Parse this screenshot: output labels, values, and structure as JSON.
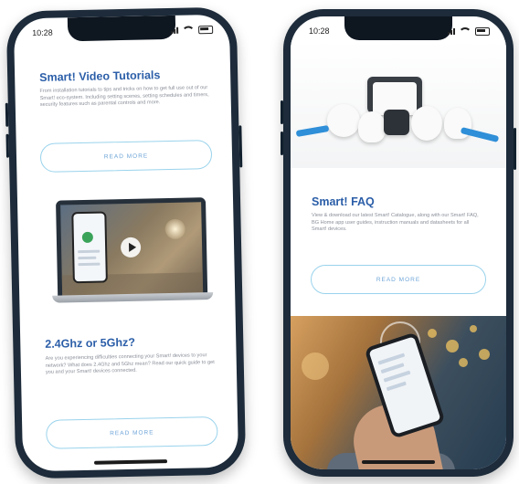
{
  "left_phone": {
    "time": "10:28",
    "section1": {
      "title": "Smart! Video Tutorials",
      "body": "From installation tutorials to tips and tricks on how to get full use out of our Smart! eco-system. Including setting scenes, setting schedules and timers, security features such as parental controls and more.",
      "button": "READ MORE"
    },
    "section2": {
      "title": "2.4Ghz or 5Ghz?",
      "body": "Are you experiencing difficulties connecting your Smart! devices to your network? What does 2.4Ghz and 5Ghz mean? Read our quick guide to get you and your Smart! devices connected.",
      "button": "READ MORE"
    }
  },
  "right_phone": {
    "time": "10:28",
    "section1": {
      "title": "Smart! FAQ",
      "body": "View & download our latest Smart! Catalogue, along with our Smart! FAQ, BG Home app user guides, instruction manuals and datasheets for all Smart! devices.",
      "button": "READ MORE"
    }
  }
}
